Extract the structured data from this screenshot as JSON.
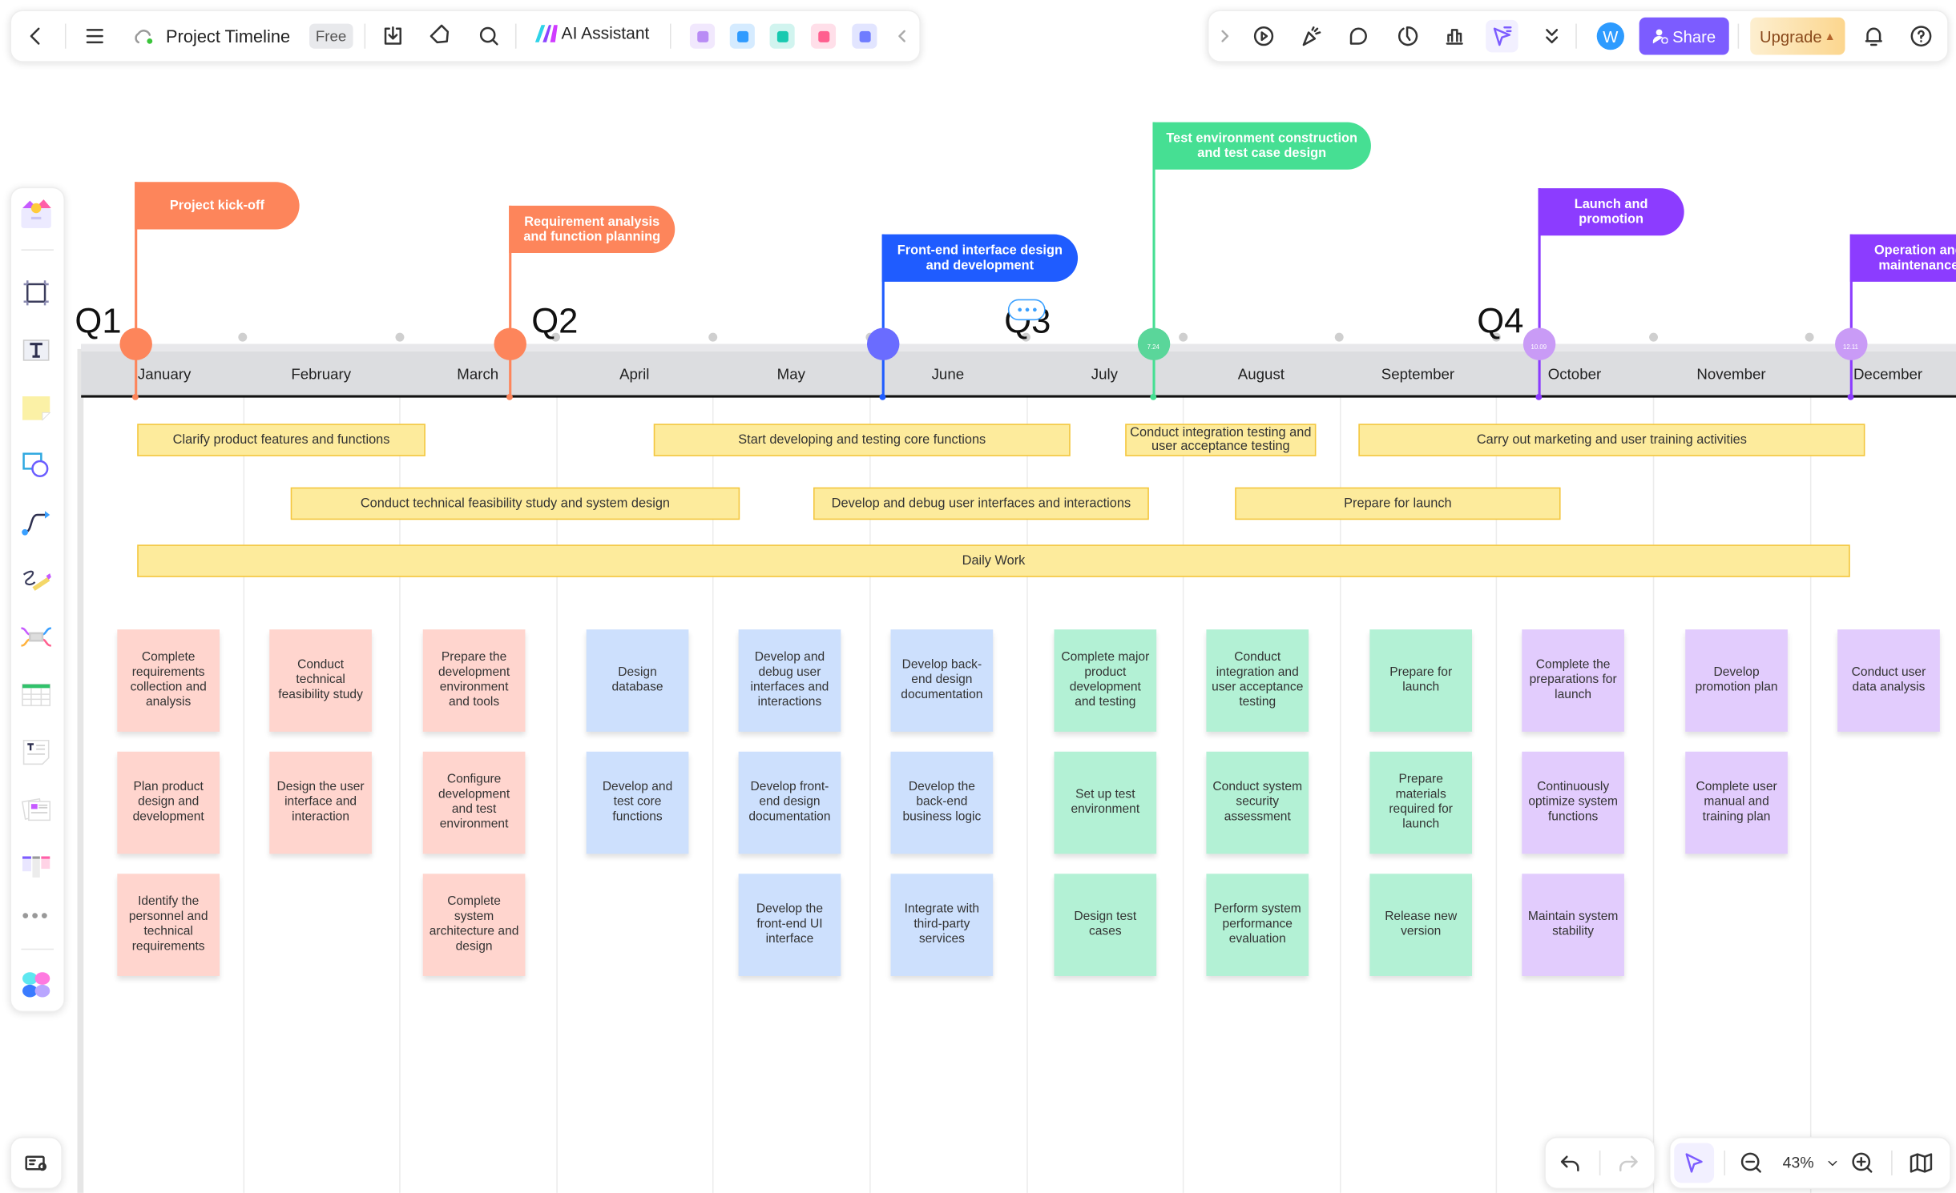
{
  "topbar": {
    "title": "Project Timeline",
    "plan_badge": "Free",
    "ai_assistant_label": "AI Assistant",
    "share_label": "Share",
    "upgrade_label": "Upgrade",
    "avatar_initial": "W",
    "apps": [
      {
        "icon": "image-generator-icon",
        "color": "#b98cf5"
      },
      {
        "icon": "presentation-icon",
        "color": "#2f9bff"
      },
      {
        "icon": "mindmap-icon",
        "color": "#19c9b0"
      },
      {
        "icon": "flowchart-icon",
        "color": "#ff5f8f"
      },
      {
        "icon": "chat-icon",
        "color": "#6f7cff"
      }
    ]
  },
  "timeline": {
    "quarters": [
      "Q1",
      "Q2",
      "Q3",
      "Q4"
    ],
    "months": [
      "January",
      "February",
      "March",
      "April",
      "May",
      "June",
      "July",
      "August",
      "September",
      "October",
      "November",
      "December"
    ],
    "milestones": [
      {
        "label": "Project kick-off",
        "date": "",
        "color": "#fd855b",
        "circle": "#fd855b"
      },
      {
        "label": "Requirement analysis and function planning",
        "date": "",
        "color": "#fd855b",
        "circle": "#fd855b"
      },
      {
        "label": "Front-end interface design and development",
        "date": "",
        "color": "#1f5cff",
        "circle": "#6a6cff"
      },
      {
        "label": "Test environment construction and test case design",
        "date": "7.24",
        "color": "#46df93",
        "circle": "#5ad69a"
      },
      {
        "label": "Launch and promotion",
        "date": "10.09",
        "color": "#8c3cff",
        "circle": "#c99bf6"
      },
      {
        "label": "Operation and maintenance",
        "date": "12.11",
        "color": "#8c3cff",
        "circle": "#c99bf6"
      }
    ],
    "bars": [
      "Clarify product features and functions",
      "Start developing and testing core functions",
      "Conduct integration testing and user acceptance testing",
      "Carry out marketing and user training activities",
      "Conduct technical feasibility study and system design",
      "Develop and debug user interfaces and interactions",
      "Prepare for launch",
      "Daily Work"
    ],
    "sticky_colors": {
      "q1": "#ffd5ce",
      "q2": "#cde0fd",
      "q3": "#b3f1d5",
      "q4": "#e2ccfd"
    },
    "stickies": [
      [
        "Complete requirements collection and analysis",
        "Plan product design and development",
        "Identify the personnel and technical requirements"
      ],
      [
        "Conduct technical feasibility study",
        "Design the user interface and interaction"
      ],
      [
        "Prepare the development environment and tools",
        "Configure development and test environment",
        "Complete system architecture and design"
      ],
      [
        "Design database",
        "Develop and test core functions"
      ],
      [
        "Develop and debug user interfaces and interactions",
        "Develop front-end design documentation",
        "Develop the front-end UI interface"
      ],
      [
        "Develop back-end design documentation",
        "Develop the back-end business logic",
        "Integrate with third-party services"
      ],
      [
        "Complete major product development and testing",
        "Set up test environment",
        "Design test cases"
      ],
      [
        "Conduct integration and user acceptance testing",
        "Conduct system security assessment",
        "Perform system performance evaluation"
      ],
      [
        "Prepare for launch",
        "Prepare materials required for launch",
        "Release new version"
      ],
      [
        "Complete the preparations for launch",
        "Continuously optimize system functions",
        "Maintain system stability"
      ],
      [
        "Develop promotion plan",
        "Complete user manual and training plan"
      ],
      [
        "Conduct user data analysis"
      ]
    ]
  },
  "bottombar": {
    "zoom_level": "43%"
  },
  "accent": "#7c5cff"
}
